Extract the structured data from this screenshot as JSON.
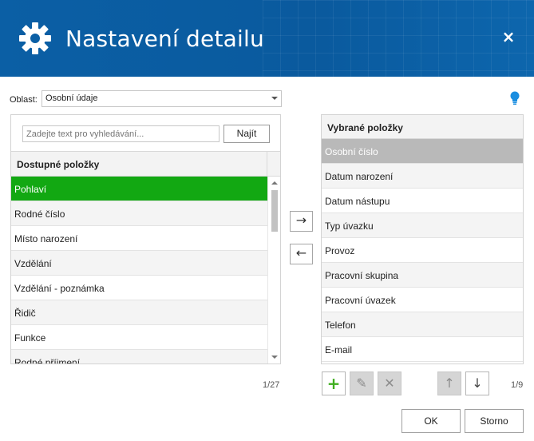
{
  "header": {
    "title": "Nastavení detailu",
    "close": "×",
    "icon": "gear-icon",
    "bg_color": "#0b5fa5"
  },
  "oblast": {
    "label": "Oblast:",
    "value": "Osobní údaje"
  },
  "search": {
    "placeholder": "Zadejte text pro vyhledávání...",
    "button": "Najít"
  },
  "available": {
    "header": "Dostupné položky",
    "items": [
      "Pohlaví",
      "Rodné číslo",
      "Místo narození",
      "Vzdělání",
      "Vzdělání - poznámka",
      "Řidič",
      "Funkce",
      "Rodné příjmení"
    ],
    "selected_color": "#12a812",
    "counter": "1/27"
  },
  "move": {
    "right": "→",
    "left": "←"
  },
  "selected": {
    "header": "Vybrané položky",
    "items": [
      "Osobní číslo",
      "Datum narození",
      "Datum nástupu",
      "Typ úvazku",
      "Provoz",
      "Pracovní skupina",
      "Pracovní úvazek",
      "Telefon",
      "E-mail"
    ],
    "counter": "1/9"
  },
  "tools": {
    "add": "+",
    "edit": "✎",
    "remove": "✕",
    "up": "↑",
    "down": "↓"
  },
  "dialog": {
    "ok": "OK",
    "cancel": "Storno"
  }
}
